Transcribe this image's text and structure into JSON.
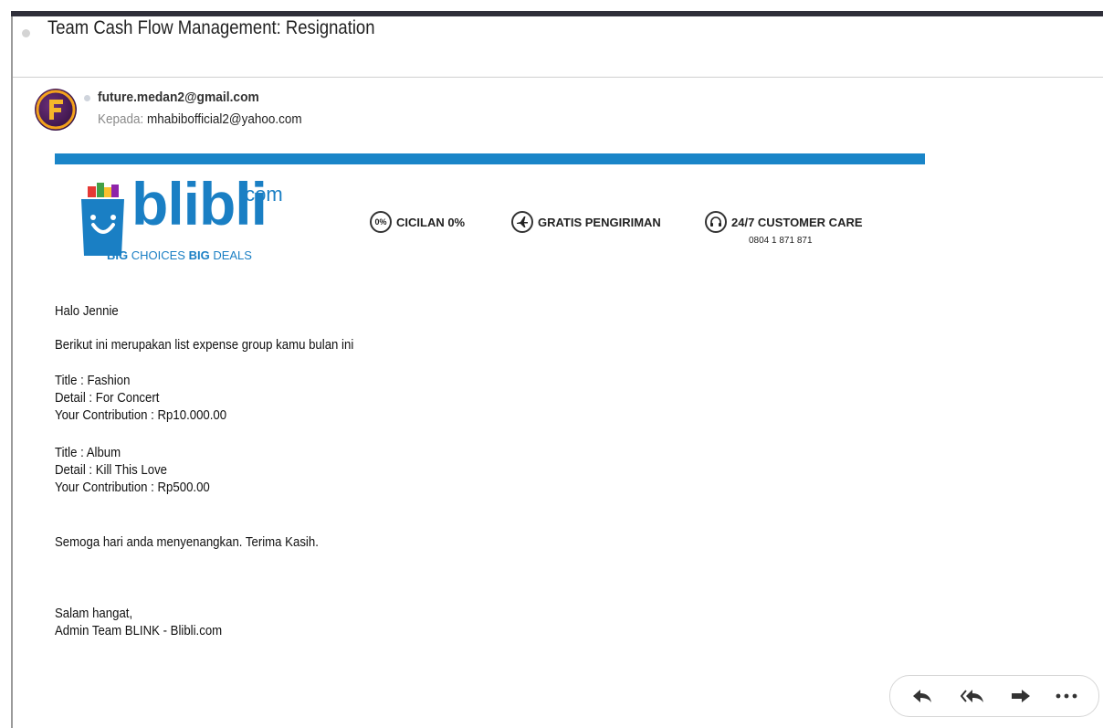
{
  "email": {
    "subject": "Team Cash Flow Management: Resignation",
    "from": "future.medan2@gmail.com",
    "to_label": "Kepada:",
    "to": "mhabibofficial2@yahoo.com"
  },
  "banner": {
    "logo_word": "blibli",
    "logo_suffix": ".com",
    "tagline_big1": "BIG",
    "tagline_choices": " CHOICES ",
    "tagline_big2": "BIG",
    "tagline_deals": " DEALS",
    "accent_color": "#1a85c8",
    "features": [
      {
        "icon": "zero-percent-icon",
        "icon_text": "0%",
        "label": "CICILAN 0%"
      },
      {
        "icon": "airplane-icon",
        "icon_text": "",
        "label": "GRATIS PENGIRIMAN"
      },
      {
        "icon": "headset-icon",
        "icon_text": "",
        "label": "24/7 CUSTOMER CARE",
        "sub": "0804 1 871 871"
      }
    ]
  },
  "body": {
    "greeting": "Halo Jennie",
    "intro": "Berikut ini merupakan list expense group kamu bulan ini",
    "items": [
      {
        "title": "Title : Fashion",
        "detail": "Detail : For Concert",
        "contribution": "Your Contribution : Rp10.000.00"
      },
      {
        "title": "Title : Album",
        "detail": "Detail : Kill This Love",
        "contribution": "Your Contribution : Rp500.00"
      }
    ],
    "closing": "Semoga hari anda menyenangkan. Terima Kasih.",
    "signoff": "Salam hangat,",
    "signature": "Admin Team BLINK - Blibli.com"
  },
  "actions": {
    "reply": "reply-icon",
    "reply_all": "reply-all-icon",
    "forward": "forward-icon",
    "more": "more-icon"
  }
}
